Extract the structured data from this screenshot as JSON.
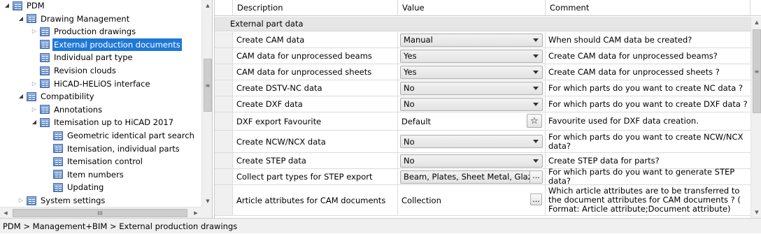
{
  "tree": {
    "nodes": [
      {
        "label": "PDM",
        "level": 0,
        "state": "open"
      },
      {
        "label": "Drawing Management",
        "level": 1,
        "state": "open"
      },
      {
        "label": "Production drawings",
        "level": 2,
        "state": "closed"
      },
      {
        "label": "External production documents",
        "level": 2,
        "state": "none",
        "selected": true
      },
      {
        "label": "Individual part type",
        "level": 2,
        "state": "none"
      },
      {
        "label": "Revision clouds",
        "level": 2,
        "state": "none"
      },
      {
        "label": "HiCAD-HELiOS interface",
        "level": 2,
        "state": "closed"
      },
      {
        "label": "Compatibility",
        "level": 1,
        "state": "open"
      },
      {
        "label": "Annotations",
        "level": 2,
        "state": "closed"
      },
      {
        "label": "Itemisation up to HiCAD 2017",
        "level": 2,
        "state": "open"
      },
      {
        "label": "Geometric identical part search",
        "level": 3,
        "state": "none"
      },
      {
        "label": "Itemisation, individual parts",
        "level": 3,
        "state": "none"
      },
      {
        "label": "Itemisation control",
        "level": 3,
        "state": "none"
      },
      {
        "label": "Item numbers",
        "level": 3,
        "state": "none"
      },
      {
        "label": "Updating",
        "level": 3,
        "state": "none"
      },
      {
        "label": "System settings",
        "level": 1,
        "state": "closed"
      }
    ],
    "hscroll_grip": "III",
    "vscroll_grip": "≡"
  },
  "grid": {
    "columns": {
      "description": "Description",
      "value": "Value",
      "comment": "Comment"
    },
    "group_label": "External part data",
    "vscroll_grip": "≡",
    "rows": [
      {
        "description": "Create CAM data",
        "value": "Manual",
        "kind": "combo",
        "comment": "When should CAM data be created?"
      },
      {
        "description": "CAM data for unprocessed beams",
        "value": "Yes",
        "kind": "combo",
        "comment": "Create CAM data for unprocessed beams?"
      },
      {
        "description": "CAM data for unprocessed sheets",
        "value": "Yes",
        "kind": "combo",
        "comment": "Create CAM data for unprocessed sheets ?"
      },
      {
        "description": "Create DSTV-NC data",
        "value": "No",
        "kind": "combo",
        "comment": "For which parts do you want to create NC data ?"
      },
      {
        "description": "Create DXF data",
        "value": "No",
        "kind": "combo",
        "comment": "For which parts do you want to create DXF data ?"
      },
      {
        "description": "DXF export Favourite",
        "value": "Default",
        "kind": "star",
        "button": "☆",
        "comment": "Favourite used for DXF data creation."
      },
      {
        "description": "Create NCW/NCX data",
        "value": "No",
        "kind": "combo",
        "comment": "For which parts do you want to create NCW/NCX data?"
      },
      {
        "description": "Create STEP data",
        "value": "No",
        "kind": "combo",
        "comment": "Create STEP data for parts?"
      },
      {
        "description": "Collect part types for STEP export",
        "value": "Beam, Plates, Sheet Metal, Glazi",
        "kind": "multi",
        "button": "...",
        "comment": "For which parts do you want to generate STEP data?"
      },
      {
        "description": "Article attributes for CAM documents",
        "value": "Collection",
        "kind": "collection",
        "button": "...",
        "comment": "Which article attributes are to be transferred to the document attributes for CAM documents ? ( Format: Article attribute;Document attribute)"
      }
    ]
  },
  "status_bar": {
    "path": "PDM > Management+BIM > External production drawings"
  }
}
